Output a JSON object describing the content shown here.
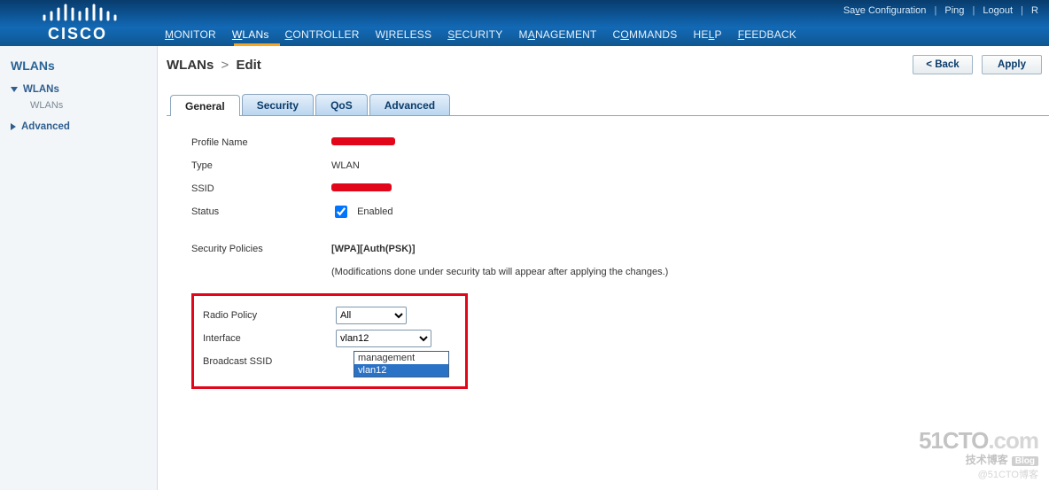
{
  "util": {
    "save": "Save Configuration",
    "ping": "Ping",
    "logout": "Logout",
    "refresh": "R"
  },
  "brand": "CISCO",
  "nav": {
    "monitor": "MONITOR",
    "wlans": "WLANs",
    "controller": "CONTROLLER",
    "wireless": "WIRELESS",
    "security": "SECURITY",
    "management": "MANAGEMENT",
    "commands": "COMMANDS",
    "help": "HELP",
    "feedback": "FEEDBACK"
  },
  "sidebar": {
    "heading": "WLANs",
    "items": [
      {
        "label": "WLANs",
        "expanded": true
      },
      {
        "label": "WLANs",
        "sub": true
      },
      {
        "label": "Advanced",
        "expanded": false
      }
    ]
  },
  "page": {
    "title_a": "WLANs",
    "title_sep": ">",
    "title_b": "Edit",
    "back": "< Back",
    "apply": "Apply"
  },
  "tabs": {
    "general": "General",
    "security": "Security",
    "qos": "QoS",
    "advanced": "Advanced"
  },
  "form": {
    "profile_name_label": "Profile Name",
    "type_label": "Type",
    "type_value": "WLAN",
    "ssid_label": "SSID",
    "status_label": "Status",
    "status_enabled": true,
    "status_text": "Enabled",
    "secpol_label": "Security Policies",
    "secpol_value": "[WPA][Auth(PSK)]",
    "secpol_note": "(Modifications done under security tab will appear after applying the changes.)",
    "radio_label": "Radio Policy",
    "radio_value": "All",
    "interface_label": "Interface",
    "interface_value": "vlan12",
    "interface_options": [
      "management",
      "vlan12"
    ],
    "bcast_label": "Broadcast SSID"
  },
  "watermark": {
    "l1a": "51CTO",
    "l1b": ".com",
    "l2a": "技术博客",
    "l2b": "Blog",
    "l3": "@51CTO博客"
  }
}
